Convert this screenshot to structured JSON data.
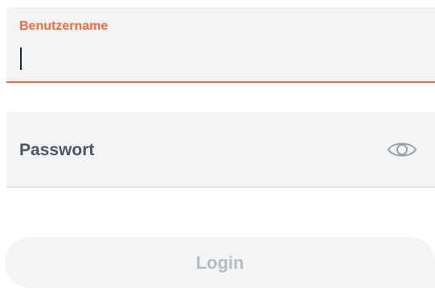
{
  "username": {
    "label": "Benutzername",
    "value": ""
  },
  "password": {
    "label": "Passwort",
    "value": "",
    "toggle_icon": "eye-icon"
  },
  "login_button": {
    "label": "Login",
    "enabled": false
  },
  "colors": {
    "accent": "#f26a3d",
    "field_background": "#f3f4f6",
    "label_text": "#4b5563",
    "disabled_text": "#b6bcc5"
  }
}
